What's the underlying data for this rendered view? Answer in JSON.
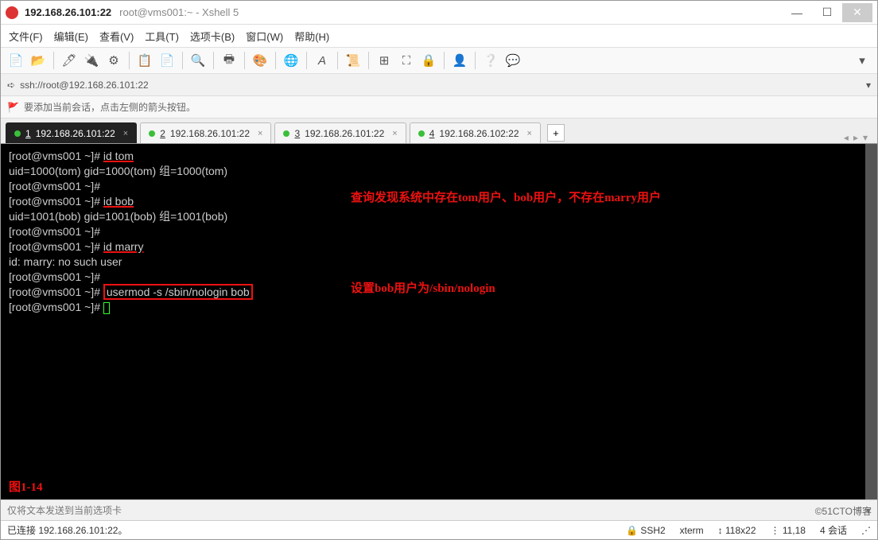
{
  "title": {
    "ip": "192.168.26.101:22",
    "rest": "root@vms001:~ - Xshell 5"
  },
  "menu": {
    "file": "文件(F)",
    "edit": "编辑(E)",
    "view": "查看(V)",
    "tools": "工具(T)",
    "tabs": "选项卡(B)",
    "window": "窗口(W)",
    "help": "帮助(H)"
  },
  "address": "ssh://root@192.168.26.101:22",
  "hint": "要添加当前会话，点击左侧的箭头按钮。",
  "tabs": [
    {
      "num": "1",
      "label": "192.168.26.101:22",
      "active": true
    },
    {
      "num": "2",
      "label": "192.168.26.101:22",
      "active": false
    },
    {
      "num": "3",
      "label": "192.168.26.101:22",
      "active": false
    },
    {
      "num": "4",
      "label": "192.168.26.102:22",
      "active": false
    }
  ],
  "terminal": {
    "prompt": "[root@vms001 ~]# ",
    "lines": [
      {
        "cmd": "id tom",
        "hl": true
      },
      {
        "out": "uid=1000(tom) gid=1000(tom) 组=1000(tom)"
      },
      {
        "cmd": ""
      },
      {
        "cmd": "id bob",
        "hl": true
      },
      {
        "out": "uid=1001(bob) gid=1001(bob) 组=1001(bob)"
      },
      {
        "cmd": ""
      },
      {
        "cmd": "id marry",
        "hl": true
      },
      {
        "out": "id: marry: no such user"
      },
      {
        "cmd": ""
      },
      {
        "cmd": "usermod -s /sbin/nologin bob",
        "box": true
      },
      {
        "cmd": "",
        "cursor": true
      }
    ],
    "annot1": "查询发现系统中存在tom用户、bob用户，不存在marry用户",
    "annot2": "设置bob用户为/sbin/nologin",
    "figlabel": "图1-14"
  },
  "sendbar": "仅将文本发送到当前选项卡",
  "status": {
    "conn": "已连接 192.168.26.101:22。",
    "proto": "SSH2",
    "term": "xterm",
    "size": "118x22",
    "pos": "11,18",
    "sess": "4 会话"
  },
  "watermark": "©51CTO博客"
}
